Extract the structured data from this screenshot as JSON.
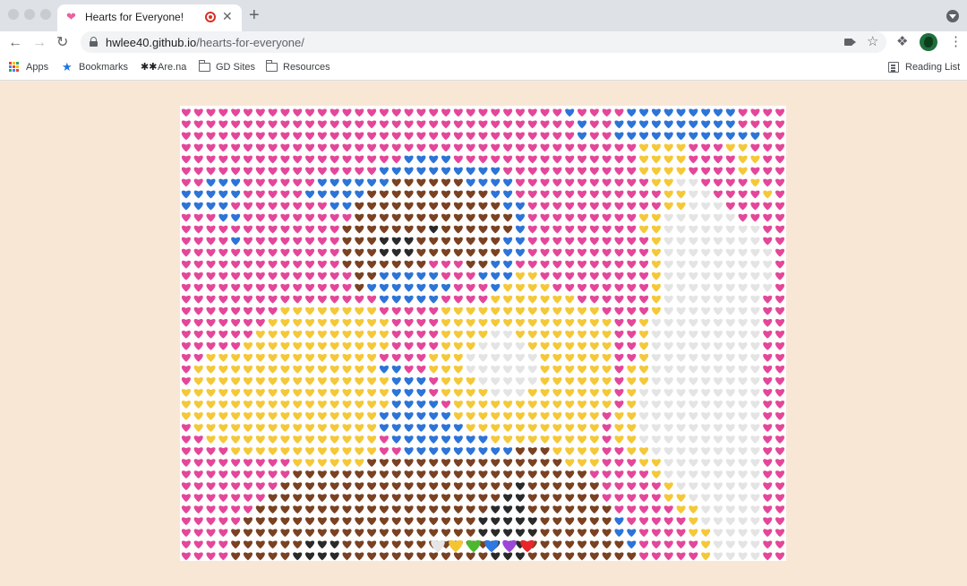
{
  "browser": {
    "tab": {
      "title": "Hearts for Everyone!"
    },
    "url": {
      "host": "hwlee40.github.io",
      "path": "/hearts-for-everyone/"
    },
    "bookmarks": [
      {
        "label": "Apps",
        "icon": "apps-grid-icon"
      },
      {
        "label": "Bookmarks",
        "icon": "star-icon"
      },
      {
        "label": "Are.na",
        "icon": "arena-icon"
      },
      {
        "label": "GD Sites",
        "icon": "folder-icon"
      },
      {
        "label": "Resources",
        "icon": "folder-icon"
      }
    ],
    "reading_list": "Reading List"
  },
  "palette": {
    "colors": [
      "#e6e6e6",
      "#f5c531",
      "#4cb82f",
      "#2f78e0",
      "#9b47d9",
      "#e8262c"
    ]
  },
  "mosaic": {
    "colors": {
      "P": "#e4479a",
      "B": "#2d74d8",
      "Y": "#f4c838",
      "W": "#e4e4e4",
      "N": "#7a4222",
      "K": "#2a2a2a"
    }
  }
}
